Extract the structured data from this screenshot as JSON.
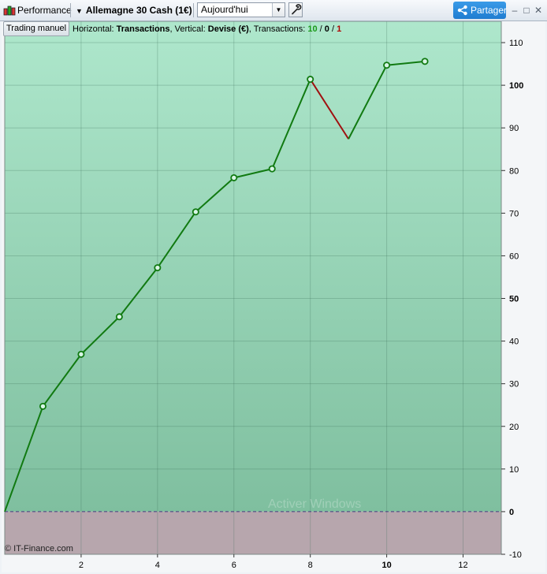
{
  "window": {
    "app_title": "Performance",
    "instrument": "Allemagne 30 Cash (1€)",
    "period": "Aujourd'hui",
    "share_label": "Partager",
    "minimize": "–",
    "maximize": "□",
    "close": "✕"
  },
  "toolbar": {
    "trading_button": "Trading manuel",
    "horizontal_label": "Horizontal: ",
    "horizontal_value": "Transactions",
    "vertical_label": ", Vertical: ",
    "vertical_value": "Devise (€)",
    "transactions_label": ", Transactions: ",
    "tx_won": "10",
    "tx_sep1": " / ",
    "tx_neutral": "0",
    "tx_sep2": " / ",
    "tx_lost": "1"
  },
  "footer": {
    "copyright": "© IT-Finance.com",
    "watermark": "Activer Windows"
  },
  "colors": {
    "up_line": "#117a11",
    "down_line": "#a01010",
    "positive_bg_top": "#aee7cc",
    "positive_bg_bottom": "#7fbf9f",
    "negative_bg": "#b7a6ad",
    "zero_line": "#4a3a80"
  },
  "chart_data": {
    "type": "line",
    "x": [
      0,
      1,
      2,
      3,
      4,
      5,
      6,
      7,
      8,
      9,
      10,
      11
    ],
    "values": [
      0,
      24.7,
      36.9,
      45.7,
      57.2,
      70.3,
      78.3,
      80.4,
      101.4,
      87.4,
      104.7,
      105.6
    ],
    "xlim": [
      0,
      13
    ],
    "ylim": [
      -10,
      115
    ],
    "x_ticks": [
      2,
      4,
      6,
      8,
      10,
      12
    ],
    "y_ticks": [
      -10,
      0,
      10,
      20,
      30,
      40,
      50,
      60,
      70,
      80,
      90,
      100,
      110
    ],
    "bold_y_ticks": [
      0,
      50,
      100
    ],
    "bold_x_ticks": [
      10
    ],
    "markers_at_highs": true,
    "grid": true,
    "xlabel": "",
    "ylabel": "",
    "title": ""
  }
}
